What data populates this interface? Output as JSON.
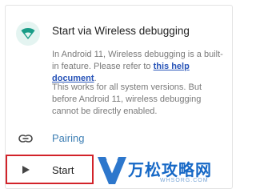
{
  "card": {
    "title": "Start via Wireless debugging",
    "paragraph1": "In Android 11, Wireless debugging is a built-in feature. Please refer to ",
    "link_text": "this help document",
    "paragraph1_end": ".",
    "paragraph2": "This works for all system versions. But before Android 11, wireless debugging cannot be directly enabled."
  },
  "actions": {
    "pairing_label": "Pairing",
    "start_label": "Start"
  },
  "icons": {
    "header": "wifi-icon",
    "pairing": "link-icon",
    "start": "play-icon"
  },
  "colors": {
    "accent": "#1a9c87",
    "link": "#2753b8",
    "pairing_text": "#3e7fb4",
    "highlight_box": "#d2232a",
    "watermark": "#1668c6"
  },
  "watermark": {
    "text": "万松攻略网",
    "sub": "WHSORG.COM"
  }
}
